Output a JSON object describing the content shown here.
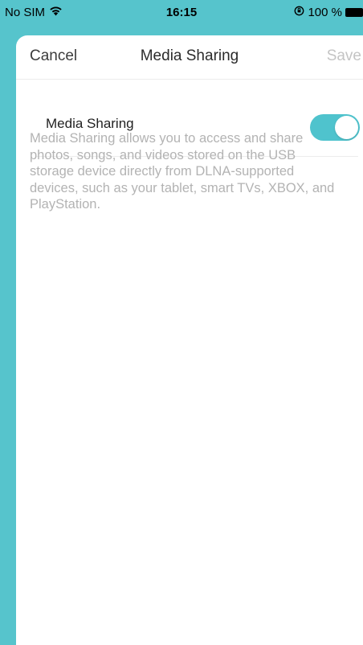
{
  "status_bar": {
    "carrier": "No SIM",
    "time": "16:15",
    "battery": "100 %",
    "wifi_icon": "wifi-icon",
    "orientation_icon": "orientation-lock-icon"
  },
  "nav": {
    "cancel_label": "Cancel",
    "title": "Media Sharing",
    "save_label": "Save"
  },
  "settings": {
    "media_sharing_label": "Media Sharing",
    "media_sharing_enabled": true
  },
  "description": "Media Sharing allows you to access and share photos, songs, and videos stored on the USB storage device directly from DLNA-supported devices, such as your tablet, smart TVs, XBOX, and PlayStation.",
  "colors": {
    "accent": "#4fc3cd",
    "background_teal": "#56c4cc",
    "disabled_text": "#c4c4c4",
    "description_text": "#b3b3b3"
  }
}
